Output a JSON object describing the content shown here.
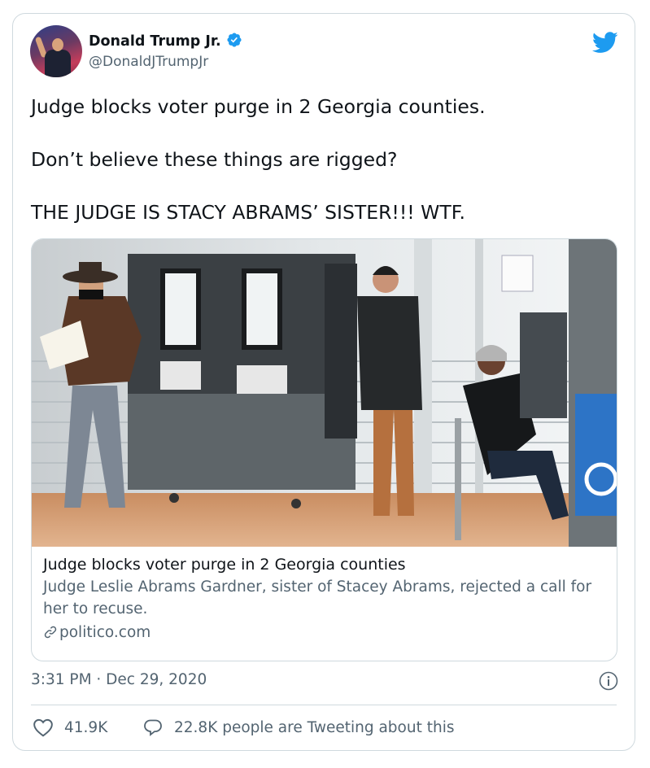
{
  "author": {
    "name": "Donald Trump Jr.",
    "handle": "@DonaldJTrumpJr",
    "verified": true
  },
  "icons": {
    "verified": "verified-badge-icon",
    "brand": "twitter-bird-icon",
    "link": "link-icon",
    "info": "info-icon",
    "like": "heart-icon",
    "reply": "speech-bubble-icon"
  },
  "tweet": {
    "lines": [
      "Judge blocks voter purge in 2 Georgia counties.",
      "Don’t believe these things are rigged?",
      "THE JUDGE IS STACY ABRAMS’ SISTER!!! WTF."
    ]
  },
  "link_card": {
    "title": "Judge blocks voter purge in 2 Georgia counties",
    "description": "Judge Leslie Abrams Gardner, sister of Stacey Abrams, rejected a call for her to recuse.",
    "domain": "politico.com"
  },
  "meta": {
    "timestamp": "3:31 PM · Dec 29, 2020"
  },
  "stats": {
    "likes": "41.9K",
    "tweeting": "22.8K people are Tweeting about this"
  },
  "colors": {
    "brand": "#1d9bf0",
    "text": "#0f1419",
    "secondary": "#536471",
    "border": "#cfd9de"
  }
}
